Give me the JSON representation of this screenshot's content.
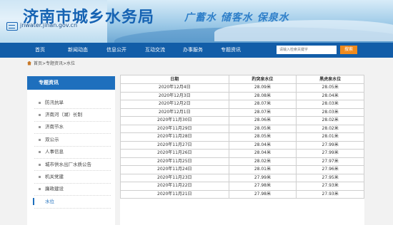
{
  "header": {
    "site_title": "济南市城乡水务局",
    "domain": "jnwater.jinan.gov.cn",
    "slogan": "广蓄水 储客水 保泉水"
  },
  "nav": {
    "items": [
      "首页",
      "新闻动态",
      "信息公开",
      "互动交流",
      "办事服务",
      "专题资讯"
    ],
    "search_placeholder": "请输入检索关键字",
    "search_button": "搜索"
  },
  "breadcrumb": {
    "text": "首页>专题资讯>水位"
  },
  "sidebar": {
    "title": "专题资讯",
    "items": [
      "防汛抗旱",
      "济南河（湖）长制",
      "济南节水",
      "双公示",
      "人事信息",
      "城市供水出厂水质公告",
      "机关党建",
      "廉政建设",
      "水位"
    ],
    "active_index": 8
  },
  "table": {
    "headers": [
      "日期",
      "趵突泉水位",
      "黑虎泉水位"
    ],
    "rows": [
      [
        "2020年12月4日",
        "28.09米",
        "28.05米"
      ],
      [
        "2020年12月3日",
        "28.08米",
        "28.04米"
      ],
      [
        "2020年12月2日",
        "28.07米",
        "28.03米"
      ],
      [
        "2020年12月1日",
        "28.07米",
        "28.03米"
      ],
      [
        "2020年11月30日",
        "28.06米",
        "28.02米"
      ],
      [
        "2020年11月29日",
        "28.05米",
        "28.02米"
      ],
      [
        "2020年11月28日",
        "28.05米",
        "28.01米"
      ],
      [
        "2020年11月27日",
        "28.04米",
        "27.99米"
      ],
      [
        "2020年11月26日",
        "28.04米",
        "27.99米"
      ],
      [
        "2020年11月25日",
        "28.02米",
        "27.97米"
      ],
      [
        "2020年11月24日",
        "28.01米",
        "27.96米"
      ],
      [
        "2020年11月23日",
        "27.99米",
        "27.95米"
      ],
      [
        "2020年11月22日",
        "27.98米",
        "27.93米"
      ],
      [
        "2020年11月21日",
        "27.98米",
        "27.93米"
      ]
    ]
  }
}
